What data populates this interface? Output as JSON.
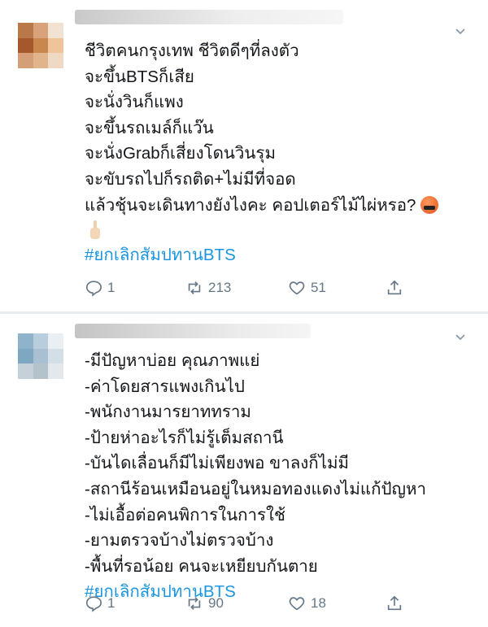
{
  "tweets": [
    {
      "lines": [
        "ชีวิตคนกรุงเทพ ชีวิตดีๆที่ลงตัว",
        "จะขึ้นBTSก็เสีย",
        "จะนั่งวินก็แพง",
        "จะขึ้นรถเมล์ก็แว๊น",
        "จะนั่งGrabก็เสี่ยงโดนวินรุม",
        "จะขับรถไปก็รถติด+ไม่มีที่จอด",
        "แล้วชุ้นจะเดินทางยังไงคะ คอปเตอร์ไม้ไผ่หรอ?"
      ],
      "hashtag": "#ยกเลิกสัมปทานBTS",
      "replies": "1",
      "retweets": "213",
      "likes": "51"
    },
    {
      "lines": [
        "-มีปัญหาบ่อย คุณภาพแย่",
        "-ค่าโดยสารแพงเกินไป",
        "-พนักงานมารยาททราม",
        "-ป้ายห่าอะไรก็ไม่รู้เต็มสถานี",
        "-บันไดเลื่อนก็มีไม่เพียงพอ ขาลงก็ไม่มี",
        "-สถานีร้อนเหมือนอยู่ในหมอทองแดงไม่แก้ปัญหา",
        "-ไม่เอื้อต่อคนพิการในการใช้",
        "-ยามตรวจบ้างไม่ตรวจบ้าง",
        "-พื้นที่รอน้อย คนจะเหยียบกันตาย"
      ],
      "hashtag": "#ยกเลิกสัมปทานBTS",
      "replies": "1",
      "retweets": "90",
      "likes": "18"
    }
  ],
  "colors": {
    "text": "#14171a",
    "hashtag": "#1b95e0",
    "action": "#657786",
    "separator": "#e6ecf0"
  },
  "icons": [
    "reply-icon",
    "retweet-icon",
    "like-icon",
    "share-icon",
    "chevron-down-icon",
    "angry-face-emoji",
    "pointing-hand-emoji"
  ]
}
